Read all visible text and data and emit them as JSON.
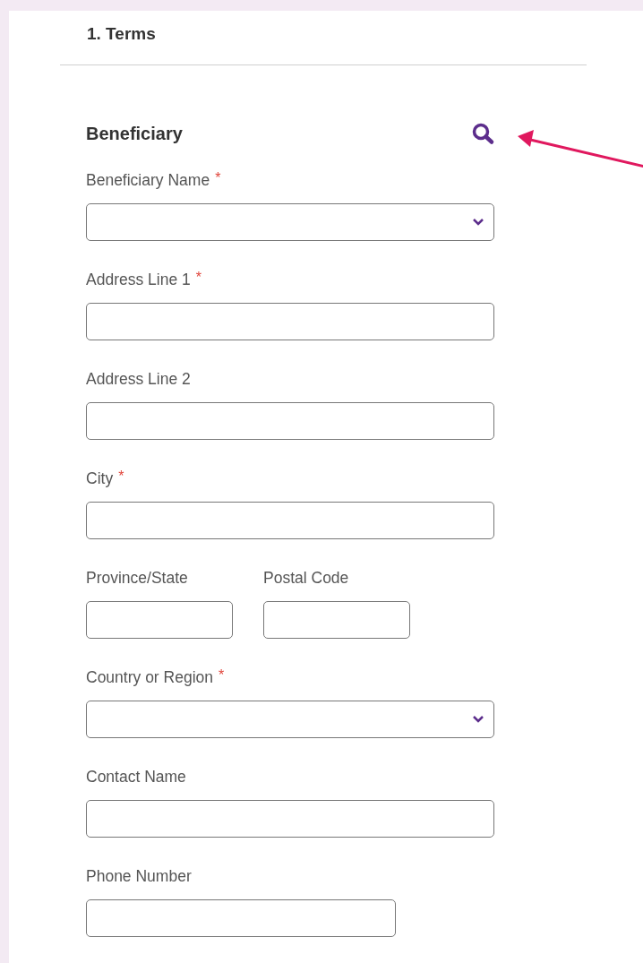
{
  "step": {
    "title": "1. Terms"
  },
  "section": {
    "title": "Beneficiary"
  },
  "rows": [
    {
      "fields": [
        {
          "label": "Beneficiary Name",
          "required_mark": "*",
          "kind": "select"
        }
      ]
    },
    {
      "fields": [
        {
          "label": "Address Line 1",
          "required_mark": "*",
          "kind": "text"
        }
      ]
    },
    {
      "fields": [
        {
          "label": "Address Line 2",
          "kind": "text"
        }
      ]
    },
    {
      "fields": [
        {
          "label": "City",
          "required_mark": "*",
          "kind": "text"
        }
      ]
    },
    {
      "fields": [
        {
          "label": "Province/State",
          "kind": "short"
        },
        {
          "label": "Postal Code",
          "kind": "short"
        }
      ]
    },
    {
      "fields": [
        {
          "label": "Country or Region",
          "required_mark": "*",
          "kind": "select"
        }
      ]
    },
    {
      "fields": [
        {
          "label": "Contact Name",
          "kind": "text"
        }
      ]
    },
    {
      "fields": [
        {
          "label": "Phone Number",
          "kind": "medium"
        }
      ]
    }
  ]
}
